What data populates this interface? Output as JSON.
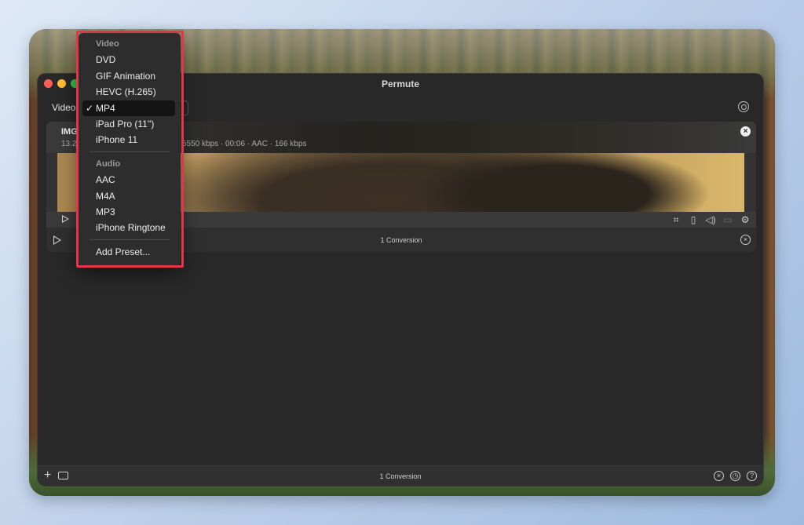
{
  "window": {
    "title": "Permute"
  },
  "preset": {
    "label": "Video"
  },
  "file": {
    "name": "IMG",
    "size": "13.2",
    "meta": "5550 kbps · 00:06 · AAC · 166 kbps"
  },
  "conversion": {
    "count_label": "1 Conversion"
  },
  "bottom_bar": {
    "count_label": "1 Conversion"
  },
  "icons": {
    "close": "×",
    "add": "+",
    "play": "play-icon",
    "crop": "crop-icon",
    "trim": "trim-icon",
    "volume": "volume-icon",
    "subtitles": "subtitles-icon",
    "settings": "settings-icon",
    "history": "clock-icon",
    "help": "?"
  },
  "menu": {
    "video_header": "Video",
    "video_items": [
      {
        "label": "DVD"
      },
      {
        "label": "GIF Animation"
      },
      {
        "label": "HEVC (H.265)"
      },
      {
        "label": "MP4",
        "selected": true
      },
      {
        "label": "iPad Pro (11'')"
      },
      {
        "label": "iPhone 11"
      }
    ],
    "check_mark": "✓",
    "audio_header": "Audio",
    "audio_items": [
      {
        "label": "AAC"
      },
      {
        "label": "M4A"
      },
      {
        "label": "MP3"
      },
      {
        "label": "iPhone Ringtone"
      }
    ],
    "add_preset": "Add Preset..."
  },
  "colors": {
    "highlight_border": "#e8344a",
    "window_bg": "#282828",
    "menu_bg": "#2d2d2d"
  }
}
